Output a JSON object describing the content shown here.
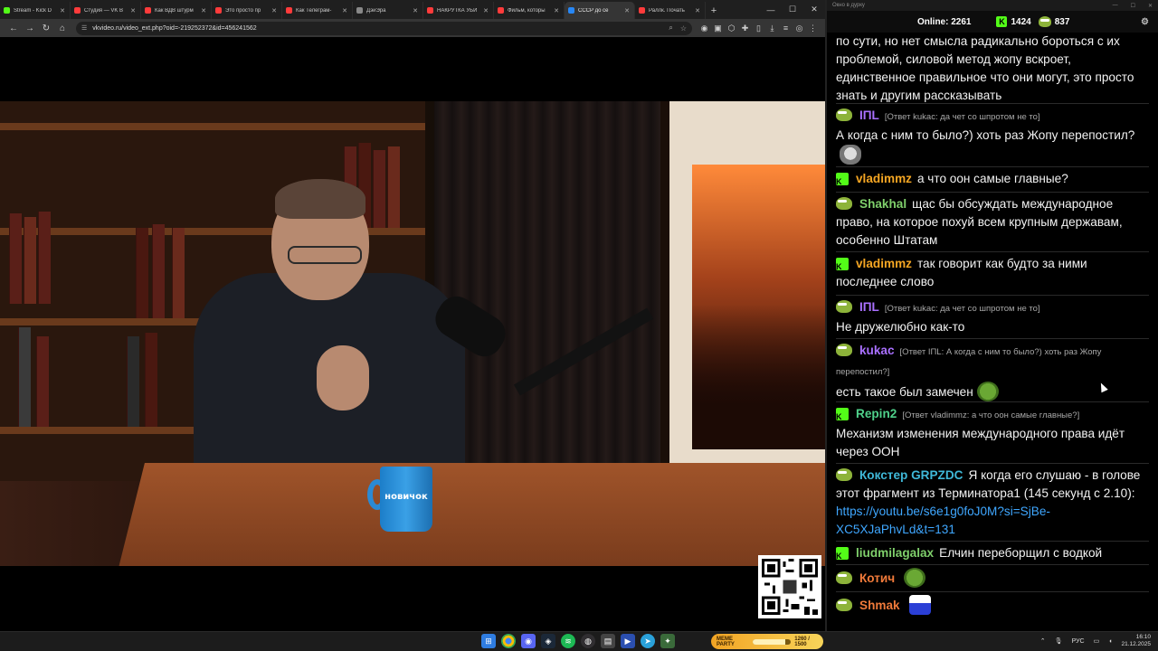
{
  "browser": {
    "tabs": [
      {
        "title": "Stream - Kick D",
        "color": "#53fc18",
        "active": false
      },
      {
        "title": "Студия — VK В",
        "color": "#ff3b3b",
        "active": false
      },
      {
        "title": "Как ВДВ штурм",
        "color": "#ff3b3b",
        "active": false
      },
      {
        "title": "Это просто пр",
        "color": "#ff3b3b",
        "active": false
      },
      {
        "title": "Как Телеграм-",
        "color": "#ff3b3b",
        "active": false
      },
      {
        "title": "ДэйЭра",
        "color": "#888888",
        "active": false
      },
      {
        "title": "НАКРУТКА УБИ",
        "color": "#ff3b3b",
        "active": false
      },
      {
        "title": "Фильм, которы",
        "color": "#ff3b3b",
        "active": false
      },
      {
        "title": "СССР до се",
        "color": "#2787f5",
        "active": true
      },
      {
        "title": "Раллк. Почать",
        "color": "#ff3b3b",
        "active": false
      }
    ],
    "url": "vkvideo.ru/video_ext.php?oid=-219252372&id=456241562"
  },
  "video": {
    "mug_text": "новичок"
  },
  "chat": {
    "title": "Окно в дурку",
    "online_label": "Online:",
    "online_count": "2261",
    "kick_count": "1424",
    "pepe_count": "837",
    "messages": [
      {
        "user": "",
        "user_color": "#ffffff",
        "badge": "none",
        "reply": "",
        "text": "по сути, но нет смысла радикально бороться с их проблемой, силовой метод жопу вскроет, единственное правильное что они могут, это просто знать и другим рассказывать",
        "emote": ""
      },
      {
        "user": "IПL",
        "user_color": "#a970ff",
        "badge": "pepe",
        "reply": "[Ответ kukac: да чет со шпротом не то]",
        "text": "А когда с ним то было?) хоть раз Жопу перепостил?",
        "emote": "cat"
      },
      {
        "user": "vladimmz",
        "user_color": "#f5a623",
        "badge": "kick",
        "reply": "",
        "text": "а что оон самые главные?",
        "emote": ""
      },
      {
        "user": "Shakhal",
        "user_color": "#7fcf6b",
        "badge": "pepe",
        "reply": "",
        "text": "щас бы обсуждать международное право, на которое похуй всем крупным державам, особенно Штатам",
        "emote": ""
      },
      {
        "user": "vladimmz",
        "user_color": "#f5a623",
        "badge": "kick",
        "reply": "",
        "text": "так говорит как будто за ними последнее слово",
        "emote": ""
      },
      {
        "user": "IПL",
        "user_color": "#a970ff",
        "badge": "pepe",
        "reply": "[Ответ kukac: да чет со шпротом не то]",
        "text": "Не дружелюбно как-то",
        "emote": ""
      },
      {
        "user": "kukac",
        "user_color": "#a970ff",
        "badge": "pepe",
        "reply": "[Ответ IПL: А когда с ним то было?) хоть раз Жопу перепостил?]",
        "text": "есть такое был замечен",
        "emote": "pepe"
      },
      {
        "user": "Repin2",
        "user_color": "#4fd08a",
        "badge": "kick",
        "reply": "[Ответ vladimmz: а что оон самые главные?]",
        "text": "Механизм изменения международного права идёт через ООН",
        "emote": ""
      },
      {
        "user": "Кокстер GRPZDC",
        "user_color": "#3fb8d8",
        "badge": "pepe",
        "reply": "",
        "text": "Я когда его слушаю - в голове этот фрагмент из Терминатора1 (145 секунд с 2.10):",
        "link": "https://youtu.be/s6e1g0foJ0M?si=SjBe-XC5XJaPhvLd&t=131",
        "emote": ""
      },
      {
        "user": "liudmilagalax",
        "user_color": "#7fcf6b",
        "badge": "kick",
        "reply": "",
        "text": "Елчин переборщил с водкой",
        "emote": ""
      },
      {
        "user": "Котич",
        "user_color": "#f07a3a",
        "badge": "pepe",
        "reply": "",
        "text": "",
        "emote": "pepe"
      },
      {
        "user": "Shmak",
        "user_color": "#f07a3a",
        "badge": "pepe",
        "reply": "",
        "text": "",
        "emote": "dance"
      }
    ]
  },
  "taskbar": {
    "meme_label": "MEME PARTY",
    "meme_progress_text": "1260 / 1500",
    "meme_progress": 0.84,
    "lang": "РУС",
    "time": "16:10",
    "date": "21.12.2025"
  },
  "colors": {
    "accent_kick": "#53fc18",
    "link": "#3fa7ff"
  }
}
